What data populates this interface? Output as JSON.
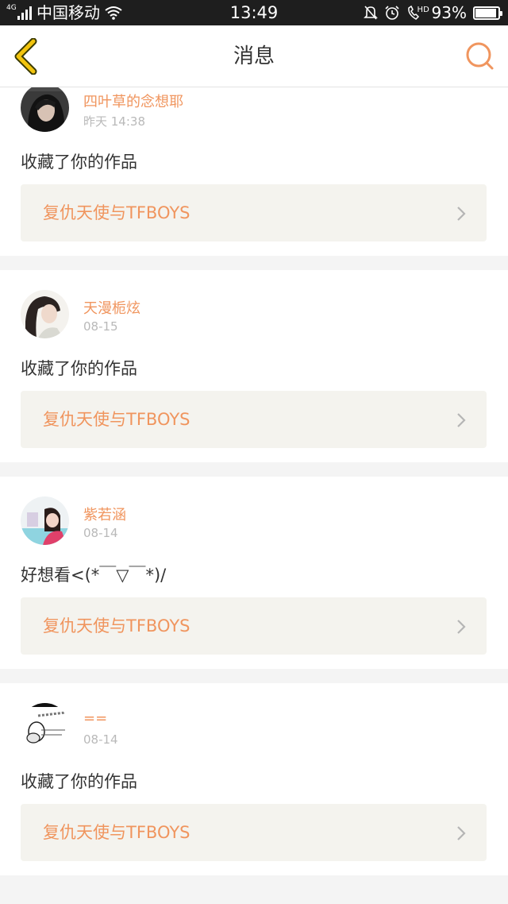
{
  "status_bar": {
    "network_tag": "4G",
    "carrier": "中国移动",
    "time": "13:49",
    "call_tag": "HD",
    "battery_percent": "93%",
    "battery_level": 0.93
  },
  "header": {
    "title": "消息"
  },
  "colors": {
    "accent": "#f0955e",
    "back_arrow": "#f2c40d",
    "card_link_bg": "#f4f3ee"
  },
  "messages": [
    {
      "username": "四叶草的念想耶",
      "timestamp": "昨天 14:38",
      "text": "收藏了你的作品",
      "work_title": "复仇天使与TFBOYS"
    },
    {
      "username": "天漫栀炫",
      "timestamp": "08-15",
      "text": "收藏了你的作品",
      "work_title": "复仇天使与TFBOYS"
    },
    {
      "username": "紫若涵",
      "timestamp": "08-14",
      "text": "好想看<(*￣▽￣*)/",
      "work_title": "复仇天使与TFBOYS"
    },
    {
      "username": "==",
      "timestamp": "08-14",
      "text": "收藏了你的作品",
      "work_title": "复仇天使与TFBOYS"
    }
  ]
}
